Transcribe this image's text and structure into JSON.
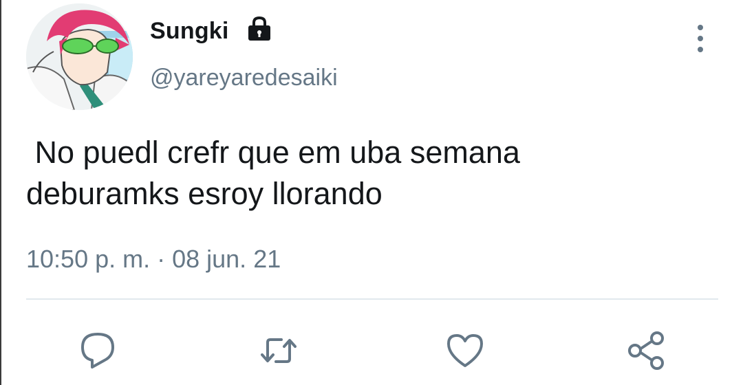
{
  "tweet": {
    "author": {
      "display_name": "Sungki",
      "handle": "@yareyaredesaiki",
      "avatar_icon": "anime-avatar",
      "protected_icon": "lock-icon"
    },
    "text": " No puedl crefr que em uba semana\ndeburamks esroy llorando",
    "timestamp": "10:50 p. m. · 08 jun. 21"
  },
  "actions": [
    {
      "name": "reply",
      "icon": "reply-icon"
    },
    {
      "name": "retweet",
      "icon": "retweet-icon"
    },
    {
      "name": "like",
      "icon": "heart-icon"
    },
    {
      "name": "share",
      "icon": "share-icon"
    }
  ],
  "colors": {
    "text": "#14171a",
    "secondary": "#657786",
    "divider": "#e1e8ed",
    "icon": "#657786"
  }
}
